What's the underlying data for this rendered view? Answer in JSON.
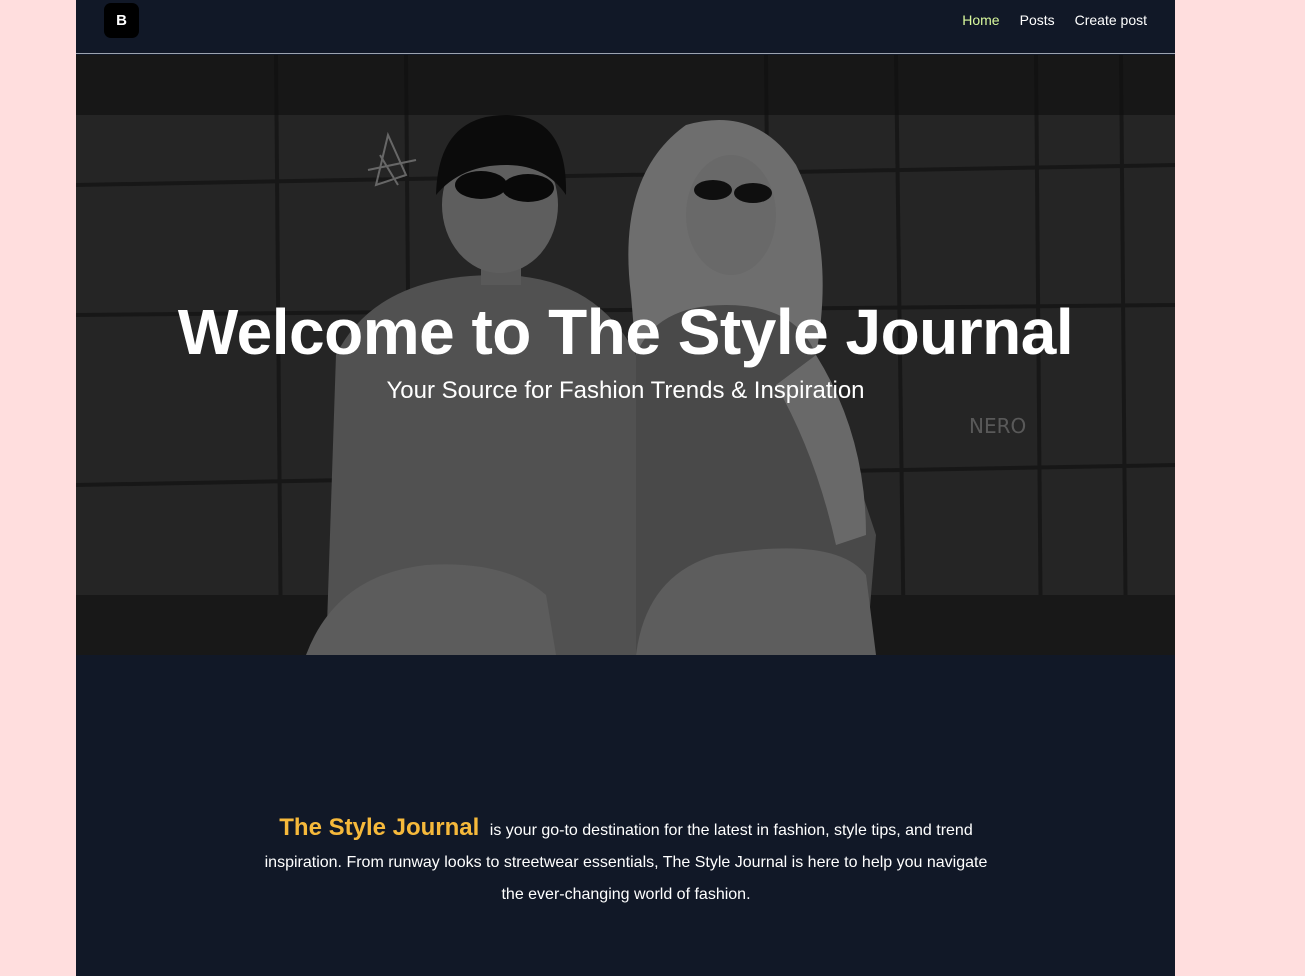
{
  "nav": {
    "logo_letter": "B",
    "links": [
      {
        "label": "Home",
        "active": true
      },
      {
        "label": "Posts",
        "active": false
      },
      {
        "label": "Create post",
        "active": false
      }
    ],
    "active_color": "#d9f99d"
  },
  "hero": {
    "title": "Welcome to The Style Journal",
    "subtitle": "Your Source for Fashion Trends & Inspiration",
    "image_description_icon": "hero-photo"
  },
  "about": {
    "brand": "The Style Journal",
    "text": "is your go-to destination for the latest in fashion, style tips, and trend inspiration. From runway looks to streetwear essentials, The Style Journal is here to help you navigate the ever-changing world of fashion.",
    "brand_color": "#f6b93b"
  },
  "colors": {
    "page_background": "#ffdede",
    "content_background": "#111827"
  }
}
